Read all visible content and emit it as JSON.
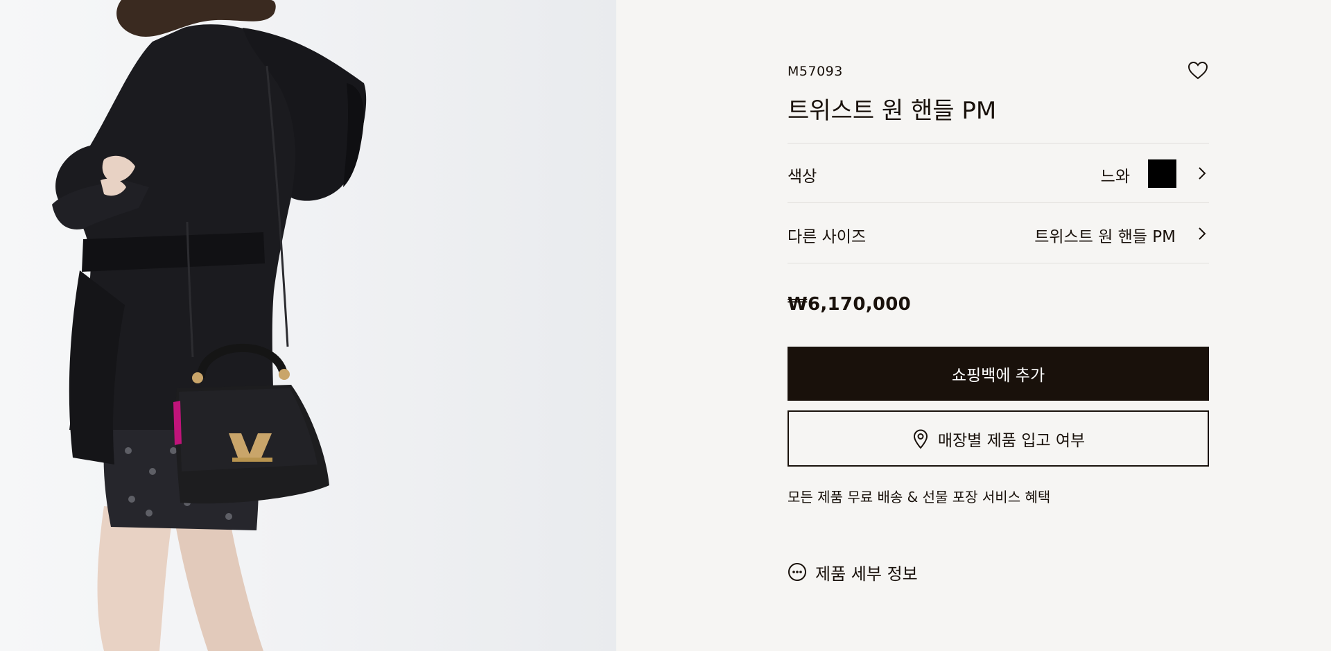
{
  "product": {
    "sku": "M57093",
    "name": "트위스트 원 핸들 PM",
    "price": "₩6,170,000",
    "photo_icon": "product-model-photo"
  },
  "options": {
    "color_label": "색상",
    "color_value": "느와",
    "color_swatch": "#000000",
    "size_label": "다른 사이즈",
    "size_value": "트위스트 원 핸들 PM"
  },
  "actions": {
    "add_to_bag": "쇼핑백에 추가",
    "store_availability": "매장별 제품 입고 여부"
  },
  "service_text": "모든 제품 무료 배송 & 선물 포장 서비스 혜택",
  "details_label": "제품 세부 정보",
  "icons": {
    "wishlist": "heart-icon",
    "chevron": "chevron-right-icon",
    "pin": "location-pin-icon",
    "details": "more-dots-icon"
  },
  "colors": {
    "background": "#f6f5f3",
    "primary": "#19110b",
    "divider": "#e1dfdc",
    "button_text": "#ffffff"
  }
}
